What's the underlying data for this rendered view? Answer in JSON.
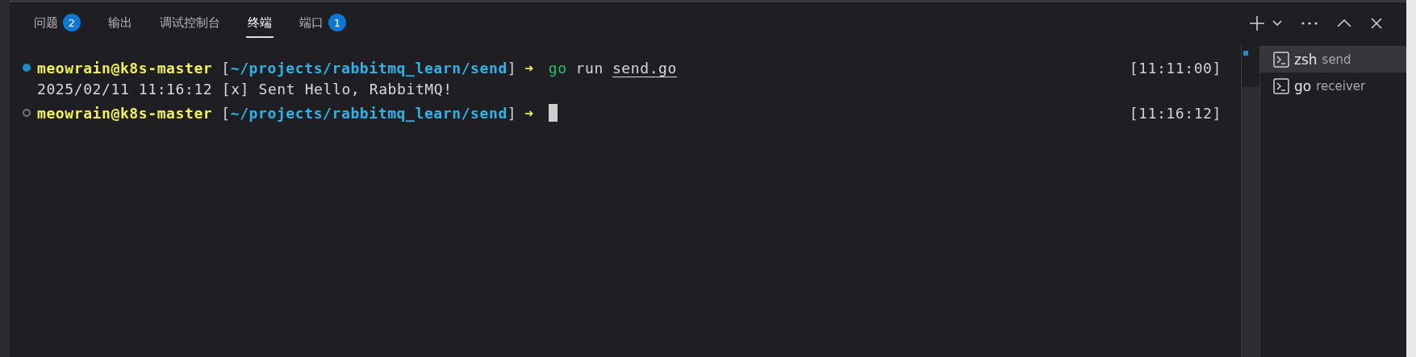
{
  "tabs": [
    {
      "label": "问题",
      "badge": "2",
      "selected": false
    },
    {
      "label": "输出",
      "selected": false
    },
    {
      "label": "调试控制台",
      "selected": false
    },
    {
      "label": "终端",
      "selected": true
    },
    {
      "label": "端口",
      "badge": "1",
      "selected": false
    }
  ],
  "actions": [
    {
      "kind": "add"
    },
    {
      "kind": "dropdown"
    },
    {
      "kind": "more"
    },
    {
      "kind": "maximize"
    },
    {
      "kind": "close"
    }
  ],
  "terminal": {
    "lines": [
      {
        "kind": "prompt",
        "succeeded": true,
        "user": "meowrain@k8s-master",
        "open": "[",
        "path": "~/projects/rabbitmq_learn/send",
        "close": "]",
        "arrow": "➜",
        "command": [
          {
            "kind": "executable",
            "text": "go"
          },
          {
            "kind": "arg",
            "text": "run"
          },
          {
            "kind": "path",
            "text": "send.go"
          }
        ],
        "cursor": false,
        "time": "[11:11:00]"
      },
      {
        "kind": "output",
        "text": "2025/02/11 11:16:12 [x] Sent Hello, RabbitMQ!"
      },
      {
        "kind": "prompt",
        "succeeded": false,
        "user": "meowrain@k8s-master",
        "open": "[",
        "path": "~/projects/rabbitmq_learn/send",
        "close": "]",
        "arrow": "➜",
        "cursor": true,
        "time": "[11:16:12]"
      }
    ]
  },
  "terminal_list": [
    {
      "shell": "zsh",
      "name": "send",
      "selected": true
    },
    {
      "shell": "go",
      "name": "receiver",
      "selected": false
    }
  ]
}
